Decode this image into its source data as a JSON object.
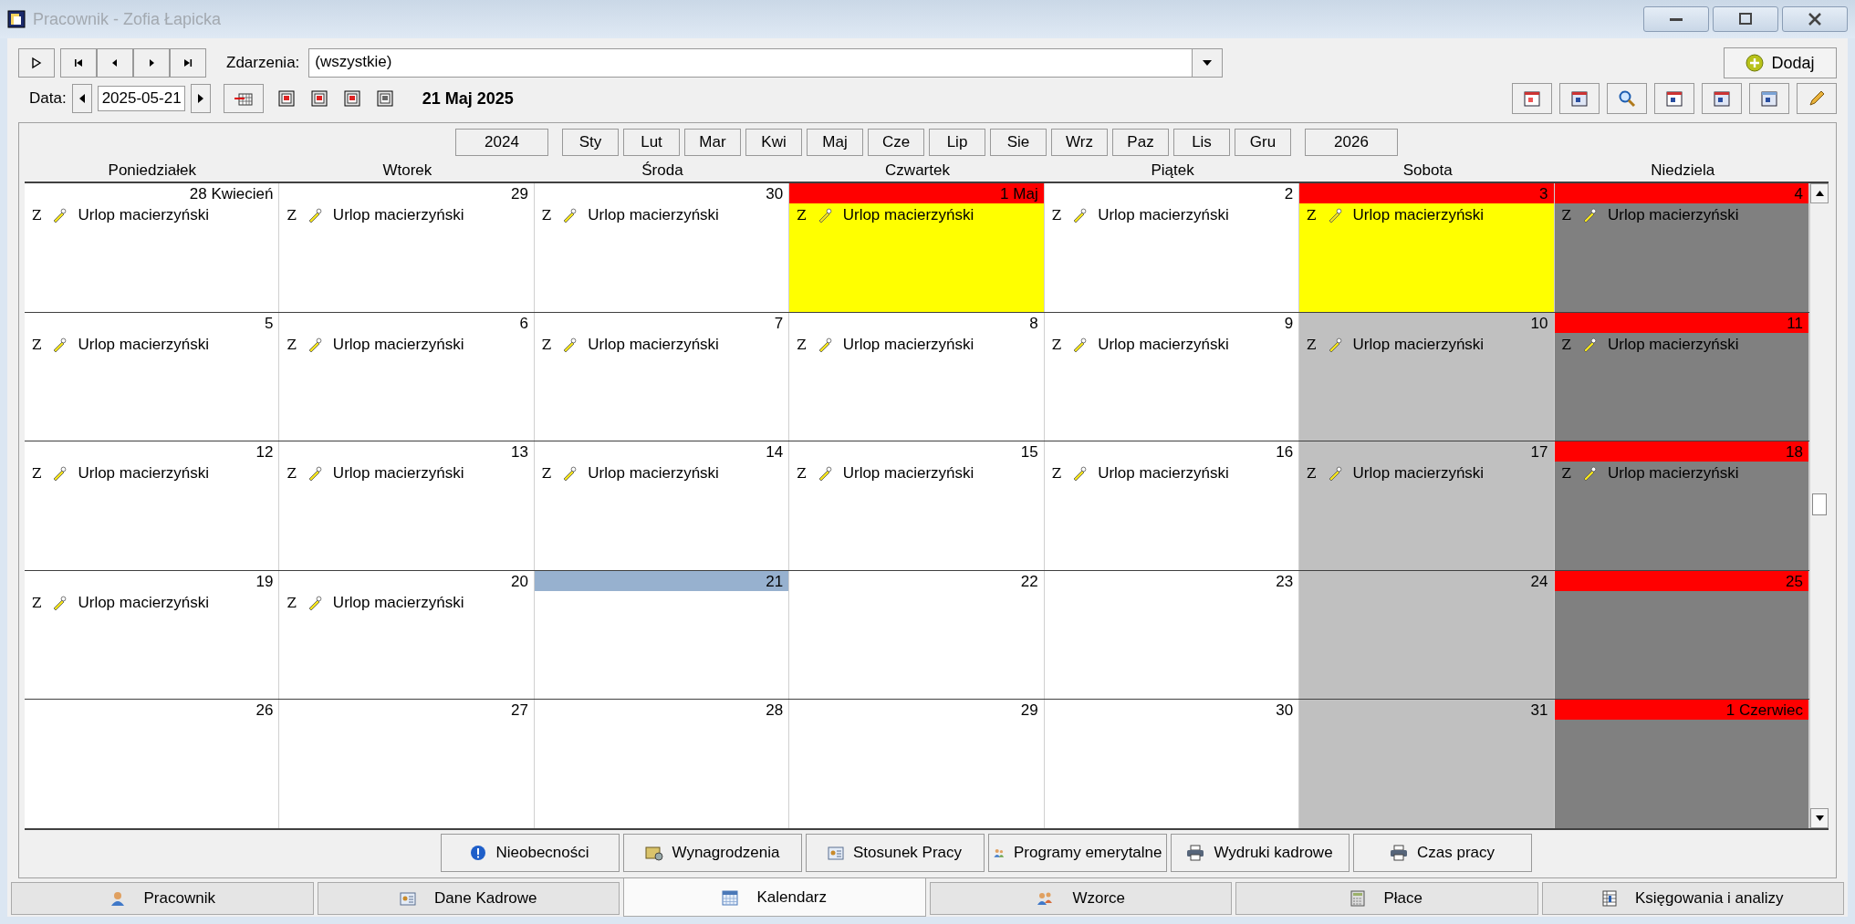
{
  "window": {
    "title": "Pracownik - Zofia Łapicka"
  },
  "toolbar": {
    "events_label": "Zdarzenia:",
    "events_value": "(wszystkie)",
    "add_button": "Dodaj",
    "date_label": "Data:",
    "date_value": "2025-05-21",
    "date_display": "21 Maj 2025"
  },
  "year_nav": {
    "previous": "2024",
    "next": "2026",
    "months": [
      "Sty",
      "Lut",
      "Mar",
      "Kwi",
      "Maj",
      "Cze",
      "Lip",
      "Sie",
      "Wrz",
      "Paz",
      "Lis",
      "Gru"
    ]
  },
  "calendar": {
    "weekdays": [
      "Poniedziałek",
      "Wtorek",
      "Środa",
      "Czwartek",
      "Piątek",
      "Sobota",
      "Niedziela"
    ],
    "weeks": [
      {
        "days": [
          {
            "label": "28 Kwiecień",
            "kind": "workday",
            "selected": false,
            "events": [
              {
                "code": "Z",
                "label": "Urlop macierzyński"
              }
            ]
          },
          {
            "label": "29",
            "kind": "workday",
            "selected": false,
            "events": [
              {
                "code": "Z",
                "label": "Urlop macierzyński"
              }
            ]
          },
          {
            "label": "30",
            "kind": "workday",
            "selected": false,
            "events": [
              {
                "code": "Z",
                "label": "Urlop macierzyński"
              }
            ]
          },
          {
            "label": "1 Maj",
            "kind": "holiday",
            "selected": false,
            "events": [
              {
                "code": "Z",
                "label": "Urlop macierzyński"
              }
            ]
          },
          {
            "label": "2",
            "kind": "workday",
            "selected": false,
            "events": [
              {
                "code": "Z",
                "label": "Urlop macierzyński"
              }
            ]
          },
          {
            "label": "3",
            "kind": "holiday",
            "selected": false,
            "events": [
              {
                "code": "Z",
                "label": "Urlop macierzyński"
              }
            ]
          },
          {
            "label": "4",
            "kind": "sunday",
            "selected": false,
            "events": [
              {
                "code": "Z",
                "label": "Urlop macierzyński"
              }
            ]
          }
        ]
      },
      {
        "days": [
          {
            "label": "5",
            "kind": "workday",
            "selected": false,
            "events": [
              {
                "code": "Z",
                "label": "Urlop macierzyński"
              }
            ]
          },
          {
            "label": "6",
            "kind": "workday",
            "selected": false,
            "events": [
              {
                "code": "Z",
                "label": "Urlop macierzyński"
              }
            ]
          },
          {
            "label": "7",
            "kind": "workday",
            "selected": false,
            "events": [
              {
                "code": "Z",
                "label": "Urlop macierzyński"
              }
            ]
          },
          {
            "label": "8",
            "kind": "workday",
            "selected": false,
            "events": [
              {
                "code": "Z",
                "label": "Urlop macierzyński"
              }
            ]
          },
          {
            "label": "9",
            "kind": "workday",
            "selected": false,
            "events": [
              {
                "code": "Z",
                "label": "Urlop macierzyński"
              }
            ]
          },
          {
            "label": "10",
            "kind": "saturday",
            "selected": false,
            "events": [
              {
                "code": "Z",
                "label": "Urlop macierzyński"
              }
            ]
          },
          {
            "label": "11",
            "kind": "sunday",
            "selected": false,
            "events": [
              {
                "code": "Z",
                "label": "Urlop macierzyński"
              }
            ]
          }
        ]
      },
      {
        "days": [
          {
            "label": "12",
            "kind": "workday",
            "selected": false,
            "events": [
              {
                "code": "Z",
                "label": "Urlop macierzyński"
              }
            ]
          },
          {
            "label": "13",
            "kind": "workday",
            "selected": false,
            "events": [
              {
                "code": "Z",
                "label": "Urlop macierzyński"
              }
            ]
          },
          {
            "label": "14",
            "kind": "workday",
            "selected": false,
            "events": [
              {
                "code": "Z",
                "label": "Urlop macierzyński"
              }
            ]
          },
          {
            "label": "15",
            "kind": "workday",
            "selected": false,
            "events": [
              {
                "code": "Z",
                "label": "Urlop macierzyński"
              }
            ]
          },
          {
            "label": "16",
            "kind": "workday",
            "selected": false,
            "events": [
              {
                "code": "Z",
                "label": "Urlop macierzyński"
              }
            ]
          },
          {
            "label": "17",
            "kind": "saturday",
            "selected": false,
            "events": [
              {
                "code": "Z",
                "label": "Urlop macierzyński"
              }
            ]
          },
          {
            "label": "18",
            "kind": "sunday",
            "selected": false,
            "events": [
              {
                "code": "Z",
                "label": "Urlop macierzyński"
              }
            ]
          }
        ]
      },
      {
        "days": [
          {
            "label": "19",
            "kind": "workday",
            "selected": false,
            "events": [
              {
                "code": "Z",
                "label": "Urlop macierzyński"
              }
            ]
          },
          {
            "label": "20",
            "kind": "workday",
            "selected": false,
            "events": [
              {
                "code": "Z",
                "label": "Urlop macierzyński"
              }
            ]
          },
          {
            "label": "21",
            "kind": "workday",
            "selected": true
          },
          {
            "label": "22",
            "kind": "workday",
            "selected": false
          },
          {
            "label": "23",
            "kind": "workday",
            "selected": false
          },
          {
            "label": "24",
            "kind": "saturday",
            "selected": false
          },
          {
            "label": "25",
            "kind": "sunday",
            "selected": false
          }
        ]
      },
      {
        "days": [
          {
            "label": "26",
            "kind": "workday",
            "selected": false
          },
          {
            "label": "27",
            "kind": "workday",
            "selected": false
          },
          {
            "label": "28",
            "kind": "workday",
            "selected": false
          },
          {
            "label": "29",
            "kind": "workday",
            "selected": false
          },
          {
            "label": "30",
            "kind": "workday",
            "selected": false
          },
          {
            "label": "31",
            "kind": "saturday",
            "selected": false
          },
          {
            "label": "1 Czerwiec",
            "kind": "sunday",
            "selected": false
          }
        ]
      }
    ]
  },
  "action_buttons": [
    {
      "label": "Nieobecności",
      "kind": "info"
    },
    {
      "label": "Wynagrodzenia",
      "kind": "money"
    },
    {
      "label": "Stosunek Pracy",
      "kind": "card"
    },
    {
      "label": "Programy emerytalne",
      "kind": "people"
    },
    {
      "label": "Wydruki kadrowe",
      "kind": "printer"
    },
    {
      "label": "Czas pracy",
      "kind": "printer"
    }
  ],
  "tabs": [
    {
      "label": "Pracownik",
      "kind": "person",
      "selected": false
    },
    {
      "label": "Dane Kadrowe",
      "kind": "card",
      "selected": false
    },
    {
      "label": "Kalendarz",
      "kind": "calendar",
      "selected": true
    },
    {
      "label": "Wzorce",
      "kind": "people",
      "selected": false
    },
    {
      "label": "Płace",
      "kind": "calculator",
      "selected": false
    },
    {
      "label": "Księgowania i analizy",
      "kind": "sheet",
      "selected": false
    }
  ]
}
